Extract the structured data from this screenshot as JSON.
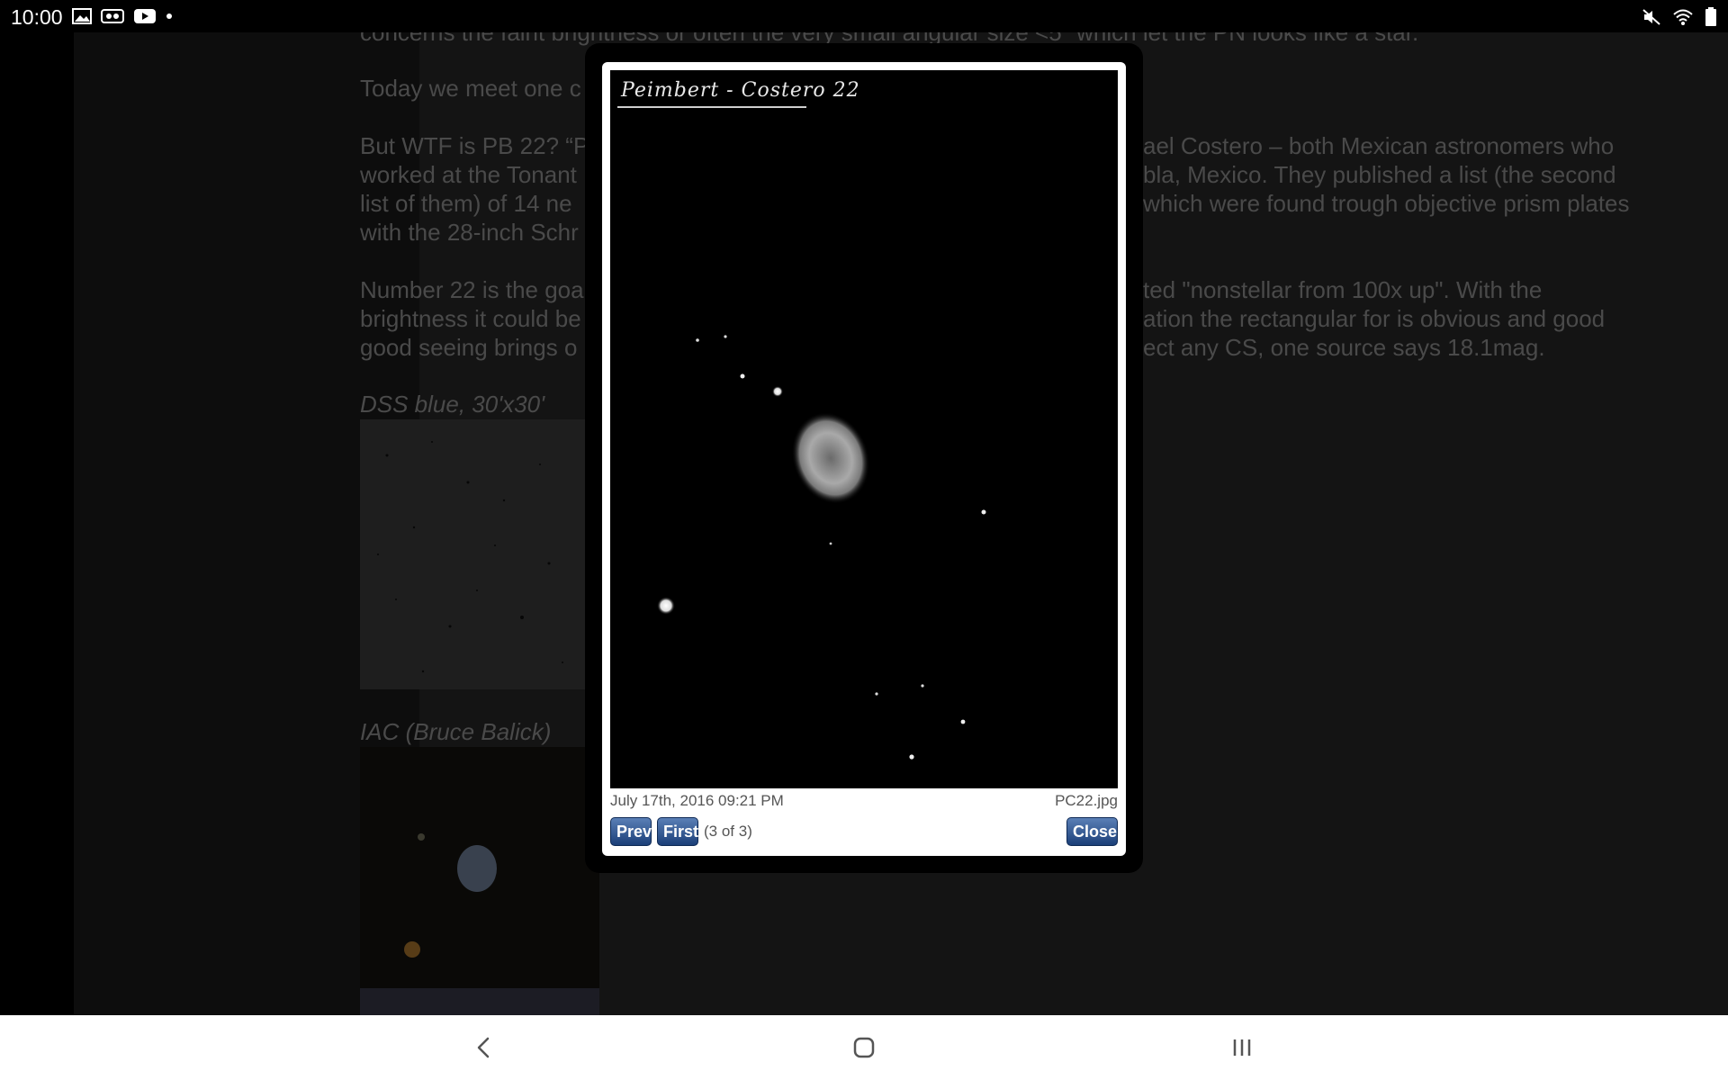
{
  "status_bar": {
    "time": "10:00",
    "left_icons": [
      "image-icon",
      "ds-icon",
      "youtube-icon",
      "dot-icon"
    ],
    "right_icons": [
      "mute-icon",
      "wifi-icon",
      "battery-icon"
    ]
  },
  "article": {
    "line_top": "concerns the faint brightness or often the very small angular size <5\" which let the PN looks like a star.",
    "para1": "Today we meet one c",
    "para2_left": [
      "But WTF is PB 22? “P",
      "worked at the Tonant",
      "list of them) of 14 ne",
      "with the 28-inch Schr"
    ],
    "para2_right": [
      "ael Costero – both Mexican astronomers who",
      "bla, Mexico. They published a list (the second",
      "which were found trough objective prism plates"
    ],
    "para3_left": [
      "Number 22 is the goa",
      "brightness it could be",
      "good seeing brings o"
    ],
    "para3_right": [
      "ted \"nonstellar from 100x up\". With the",
      "ation the rectangular for is obvious and good",
      "ect any CS, one source says 18.1mag."
    ],
    "caption_dss": "DSS blue, 30'x30'",
    "caption_iac": "IAC (Bruce Balick)"
  },
  "lightbox": {
    "photo_title": "Peimbert - Costero 22",
    "date": "July 17th, 2016 09:21 PM",
    "filename": "PC22.jpg",
    "prev_label": "Prev",
    "first_label": "First",
    "counter": "(3 of 3)",
    "close_label": "Close"
  },
  "nav_bar": {
    "buttons": [
      "back-icon",
      "home-icon",
      "recents-icon"
    ]
  }
}
